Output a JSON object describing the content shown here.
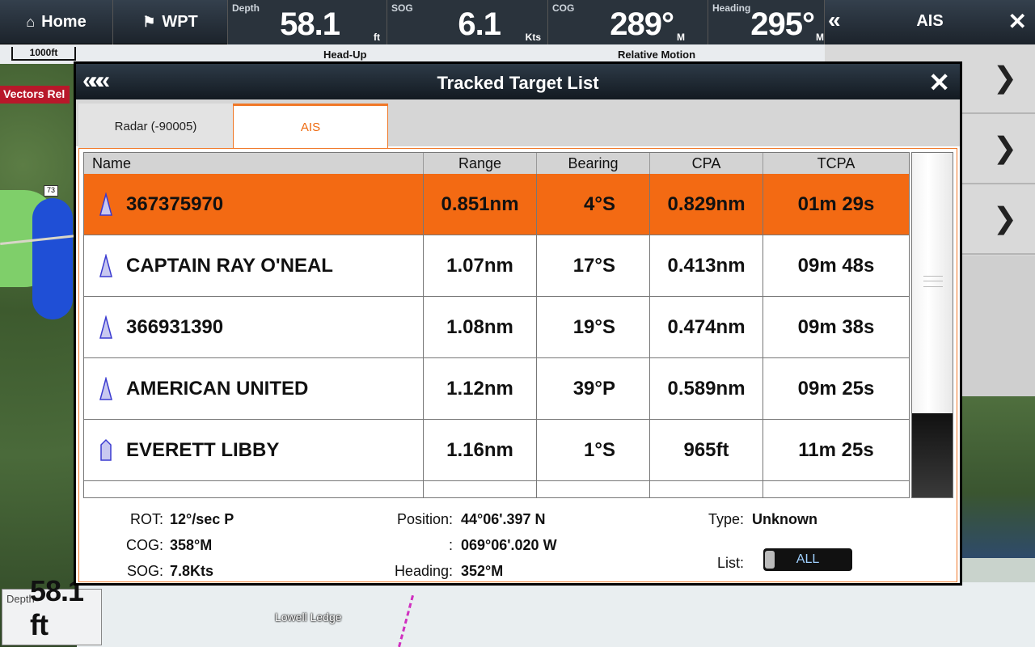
{
  "topbar": {
    "home_label": "Home",
    "wpt_label": "WPT",
    "depth": {
      "label": "Depth",
      "value": "58.1",
      "unit": "ft"
    },
    "sog": {
      "label": "SOG",
      "value": "6.1",
      "unit": "Kts"
    },
    "cog": {
      "label": "COG",
      "value": "289°",
      "unit": "M"
    },
    "heading": {
      "label": "Heading",
      "value": "295°",
      "unit": "M"
    }
  },
  "subbar": {
    "scale": "1000ft",
    "orientation": "Head-Up",
    "motion": "Relative Motion"
  },
  "vectors_rel": "Vectors Rel",
  "right_panel": {
    "title": "AIS"
  },
  "map": {
    "place_label": "Lowell Ledge",
    "road_shield": "73"
  },
  "bottom_depth": {
    "label": "Depth",
    "value": "58.1 ft"
  },
  "dialog": {
    "title": "Tracked Target List",
    "tabs": [
      {
        "label": "Radar (-90005)",
        "active": false
      },
      {
        "label": "AIS",
        "active": true
      }
    ],
    "columns": [
      "Name",
      "Range",
      "Bearing",
      "CPA",
      "TCPA"
    ],
    "rows": [
      {
        "name": "367375970",
        "range": "0.851nm",
        "bearing": "4°S",
        "cpa": "0.829nm",
        "tcpa": "01m 29s",
        "selected": true,
        "icon": "ais-vessel-icon"
      },
      {
        "name": "CAPTAIN RAY O'NEAL",
        "range": "1.07nm",
        "bearing": "17°S",
        "cpa": "0.413nm",
        "tcpa": "09m 48s",
        "selected": false,
        "icon": "ais-vessel-icon"
      },
      {
        "name": "366931390",
        "range": "1.08nm",
        "bearing": "19°S",
        "cpa": "0.474nm",
        "tcpa": "09m 38s",
        "selected": false,
        "icon": "ais-vessel-icon"
      },
      {
        "name": "AMERICAN UNITED",
        "range": "1.12nm",
        "bearing": "39°P",
        "cpa": "0.589nm",
        "tcpa": "09m 25s",
        "selected": false,
        "icon": "ais-vessel-icon"
      },
      {
        "name": "EVERETT LIBBY",
        "range": "1.16nm",
        "bearing": "1°S",
        "cpa": "965ft",
        "tcpa": "11m 25s",
        "selected": false,
        "icon": "ais-static-icon"
      }
    ],
    "details": {
      "rot_label": "ROT:",
      "rot_value": "12°/sec P",
      "cog_label": "COG:",
      "cog_value": "358°M",
      "sog_label": "SOG:",
      "sog_value": "7.8Kts",
      "position_label": "Position:",
      "position_lat": "44°06'.397 N",
      "position_lon_label": ":",
      "position_lon": "069°06'.020 W",
      "heading_label": "Heading:",
      "heading_value": "352°M",
      "type_label": "Type:",
      "type_value": "Unknown",
      "list_label": "List:",
      "list_value": "ALL"
    }
  },
  "colors": {
    "accent": "#f36a13",
    "selected_row": "#f36a13",
    "header_dark": "#1c232b",
    "target_icon": "#3a3ad0"
  }
}
